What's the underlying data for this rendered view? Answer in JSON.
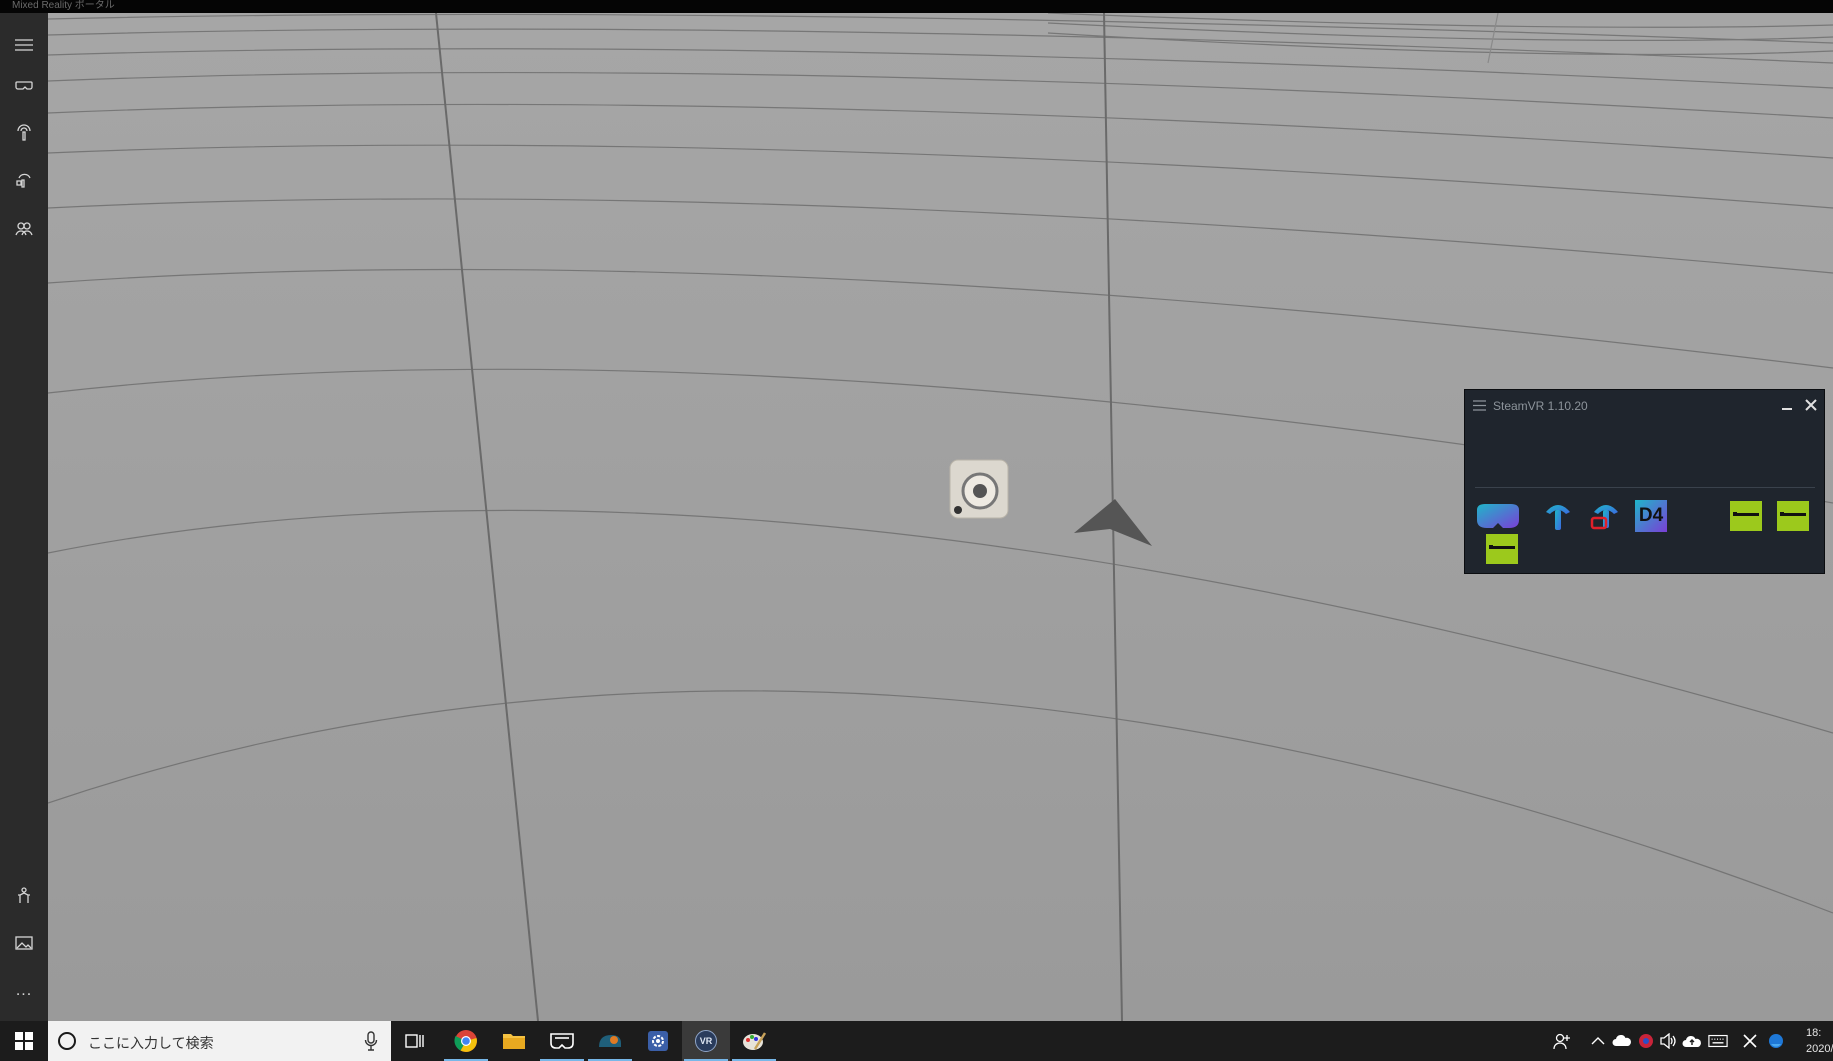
{
  "window": {
    "title": "Mixed Reality ポータル"
  },
  "sidebar": {
    "items": [
      {
        "icon": "hamburger-menu-icon"
      },
      {
        "icon": "headset-icon"
      },
      {
        "icon": "motion-controller-icon"
      },
      {
        "icon": "controllers-pair-icon"
      },
      {
        "icon": "people-icon"
      },
      {
        "icon": "boundary-setup-icon"
      },
      {
        "icon": "gallery-icon"
      },
      {
        "icon": "more-icon",
        "label": "..."
      }
    ]
  },
  "steamvr": {
    "title": "SteamVR 1.10.20",
    "devices": [
      {
        "icon": "vr-headset-icon"
      },
      {
        "icon": "controller-icon"
      },
      {
        "icon": "controller-warning-icon"
      },
      {
        "icon": "d4-icon",
        "label": "D4"
      },
      {
        "icon": "base-station-icon"
      },
      {
        "icon": "base-station-icon"
      },
      {
        "icon": "base-station-icon"
      }
    ],
    "colors": {
      "accent": "#9cc91c",
      "panel": "#1f252d"
    }
  },
  "taskbar": {
    "search_placeholder": "ここに入力して検索",
    "apps": [
      {
        "icon": "chrome-icon"
      },
      {
        "icon": "file-explorer-icon"
      },
      {
        "icon": "mixed-reality-portal-icon"
      },
      {
        "icon": "disk-app-icon"
      },
      {
        "icon": "settings-gear-icon"
      },
      {
        "icon": "steamvr-icon",
        "label": "VR"
      },
      {
        "icon": "paint-app-icon"
      }
    ],
    "clock": {
      "time": "18:",
      "date": "2020/"
    }
  }
}
